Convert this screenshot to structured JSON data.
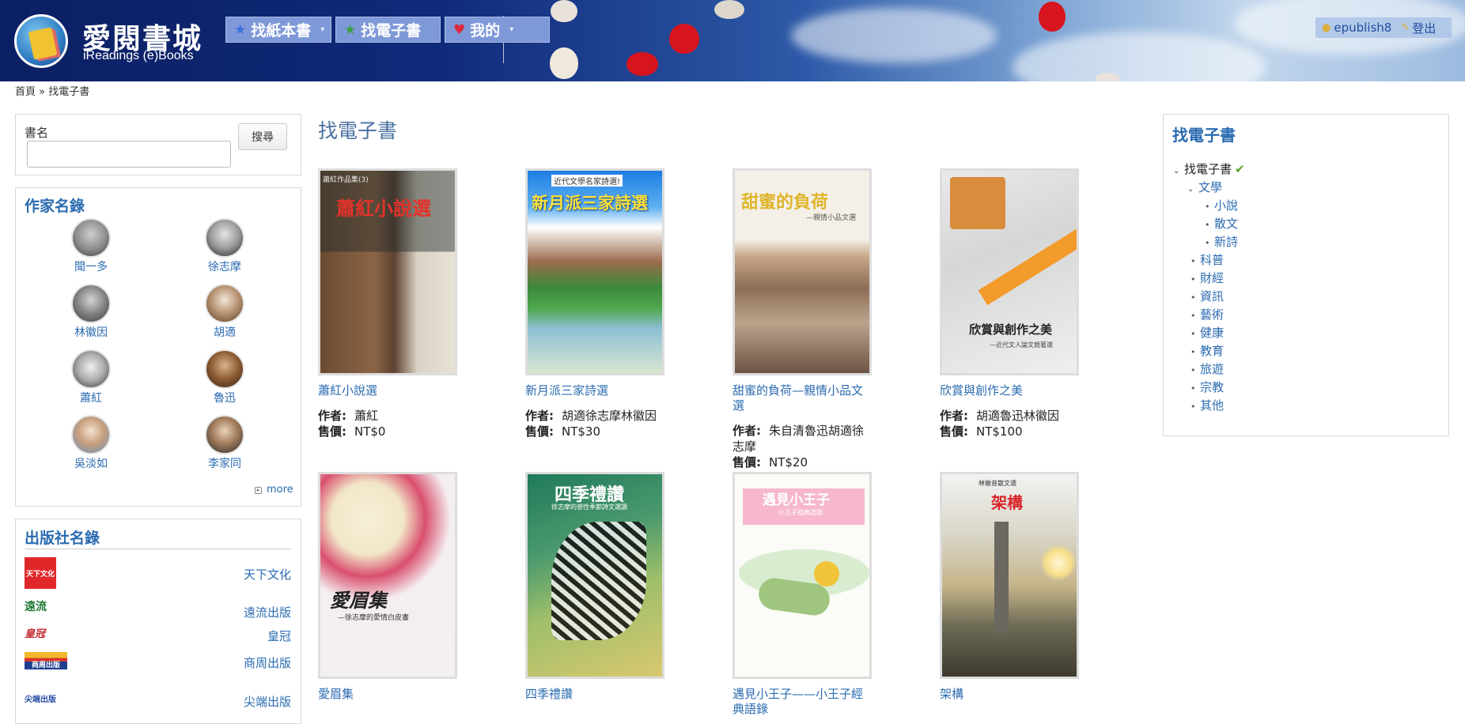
{
  "header": {
    "brand_title": "愛閱書城",
    "brand_subtitle": "iReadings (e)Books",
    "nav": [
      {
        "label": "找紙本書",
        "icon": "star-blue-icon",
        "has_dropdown": true
      },
      {
        "label": "找電子書",
        "icon": "star-green-icon",
        "has_dropdown": false
      },
      {
        "label": "我的",
        "icon": "heart-icon",
        "has_dropdown": true
      }
    ],
    "user": {
      "username": "epublish8",
      "logout_label": "登出"
    }
  },
  "breadcrumb": {
    "home": "首頁",
    "separator": "»",
    "current": "找電子書"
  },
  "sidebar": {
    "search": {
      "label": "書名",
      "value": "",
      "button_label": "搜尋"
    },
    "authors": {
      "title": "作家名錄",
      "items": [
        {
          "name": "聞一多"
        },
        {
          "name": "徐志摩"
        },
        {
          "name": "林徽因"
        },
        {
          "name": "胡適"
        },
        {
          "name": "蕭紅"
        },
        {
          "name": "魯迅"
        },
        {
          "name": "吳淡如"
        },
        {
          "name": "李家同"
        }
      ],
      "more_label": "more"
    },
    "publishers": {
      "title": "出版社名錄",
      "items": [
        {
          "name": "天下文化",
          "logo_text": "天下文化",
          "logo_color": "#e0282b"
        },
        {
          "name": "遠流出版",
          "logo_text": "遠流",
          "logo_color": "#1d7a35"
        },
        {
          "name": "皇冠",
          "logo_text": "皇冠",
          "logo_color": "#c2272d"
        },
        {
          "name": "商周出版",
          "logo_text": "商周出版",
          "logo_color": "#1e3f8f"
        },
        {
          "name": "尖端出版",
          "logo_text": "尖端出版",
          "logo_color": "#2c4fa5"
        }
      ]
    }
  },
  "main": {
    "title": "找電子書",
    "author_label": "作者:",
    "price_label": "售價:",
    "books": [
      {
        "title": "蕭紅小說選",
        "author": "蕭紅",
        "price": "NT$0",
        "cover_text": "蕭紅小說選",
        "cover_small": "蕭紅作品集(3)"
      },
      {
        "title": "新月派三家詩選",
        "author": "胡適徐志摩林徽因",
        "price": "NT$30",
        "cover_text": "新月派三家詩選",
        "cover_small": "近代文學名家詩選!"
      },
      {
        "title": "甜蜜的負荷—親情小品文選",
        "author": "朱自清魯迅胡適徐志摩",
        "price": "NT$20",
        "cover_text": "甜蜜的負荷",
        "cover_small": "—親情小品文選"
      },
      {
        "title": "欣賞與創作之美",
        "author": "胡適魯迅林徽因",
        "price": "NT$100",
        "cover_text": "欣賞與創作之美",
        "cover_small": "—近代文人論文競著選"
      },
      {
        "title": "愛眉集",
        "author": "",
        "price": "",
        "cover_text": "愛眉集",
        "cover_small": "—徐志摩的愛情白皮書"
      },
      {
        "title": "四季禮讚",
        "author": "",
        "price": "",
        "cover_text": "四季禮讚",
        "cover_small": "徐志摩的感性季節詩文選讀"
      },
      {
        "title": "遇見小王子——小王子經典語錄",
        "author": "",
        "price": "",
        "cover_text": "遇見小王子",
        "cover_small": "小王子經典語錄"
      },
      {
        "title": "架構",
        "author": "",
        "price": "",
        "cover_text": "架構",
        "cover_small": "林徽音散文選"
      }
    ]
  },
  "categories": {
    "title": "找電子書",
    "root": "找電子書",
    "literature": "文學",
    "literature_children": [
      "小說",
      "散文",
      "新詩"
    ],
    "others": [
      "科普",
      "財經",
      "資訊",
      "藝術",
      "健康",
      "教育",
      "旅遊",
      "宗教",
      "其他"
    ]
  }
}
